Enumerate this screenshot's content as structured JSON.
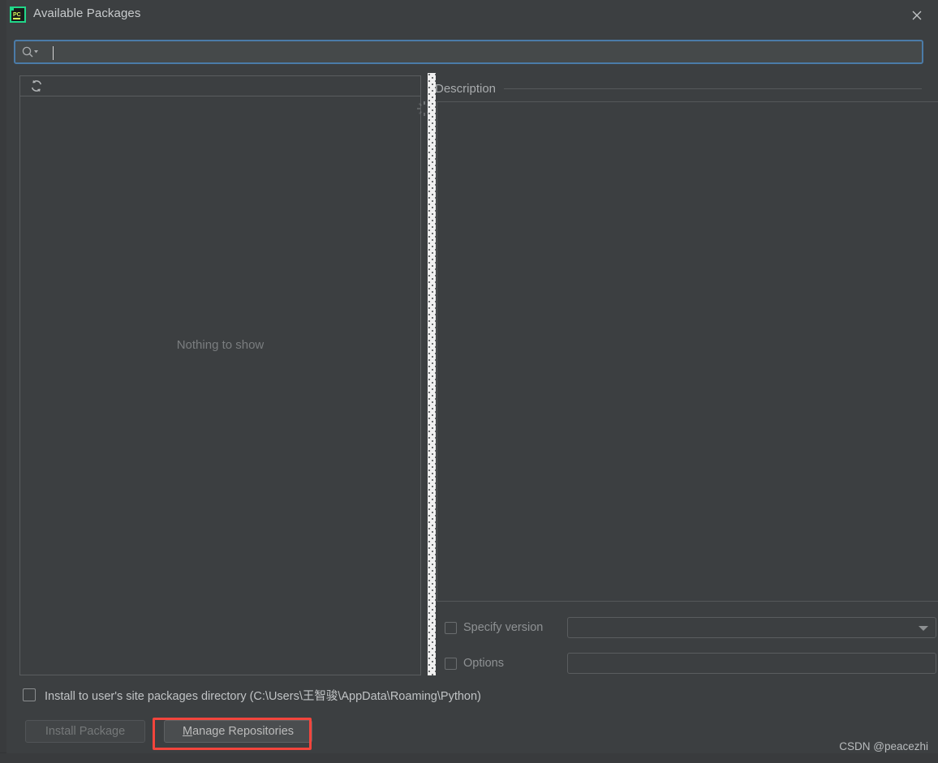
{
  "window": {
    "title": "Available Packages",
    "app_icon": "pycharm-icon",
    "close_icon": "close-icon"
  },
  "search": {
    "value": "",
    "placeholder": "",
    "icon": "search-icon"
  },
  "packages_panel": {
    "refresh_icon": "refresh-icon",
    "loading_icon": "loading-spinner-icon",
    "empty_text": "Nothing to show",
    "items": []
  },
  "splitter": {
    "name": "vertical-splitter"
  },
  "description_panel": {
    "title": "Description",
    "body_text": ""
  },
  "options": {
    "specify_version": {
      "label": "Specify version",
      "checked": false,
      "value": "",
      "dropdown_icon": "chevron-down-icon"
    },
    "extra_options": {
      "label": "Options",
      "checked": false,
      "value": ""
    }
  },
  "footer": {
    "user_site_checkbox": {
      "label": "Install to user's site packages directory (C:\\Users\\王智骏\\AppData\\Roaming\\Python)",
      "checked": false
    },
    "install_button": {
      "label": "Install Package",
      "enabled": false
    },
    "manage_button": {
      "mnemonic": "M",
      "label_rest": "anage Repositories",
      "highlighted": true
    }
  },
  "watermark": {
    "text": "CSDN @peacezhi"
  },
  "colors": {
    "dialog_bg": "#3c3f41",
    "panel_border": "#5a5d5f",
    "focus_border": "#4b7ba8",
    "text": "#bbbbbb",
    "muted_text": "#7a7d7f",
    "highlight_red": "#f3453c"
  }
}
